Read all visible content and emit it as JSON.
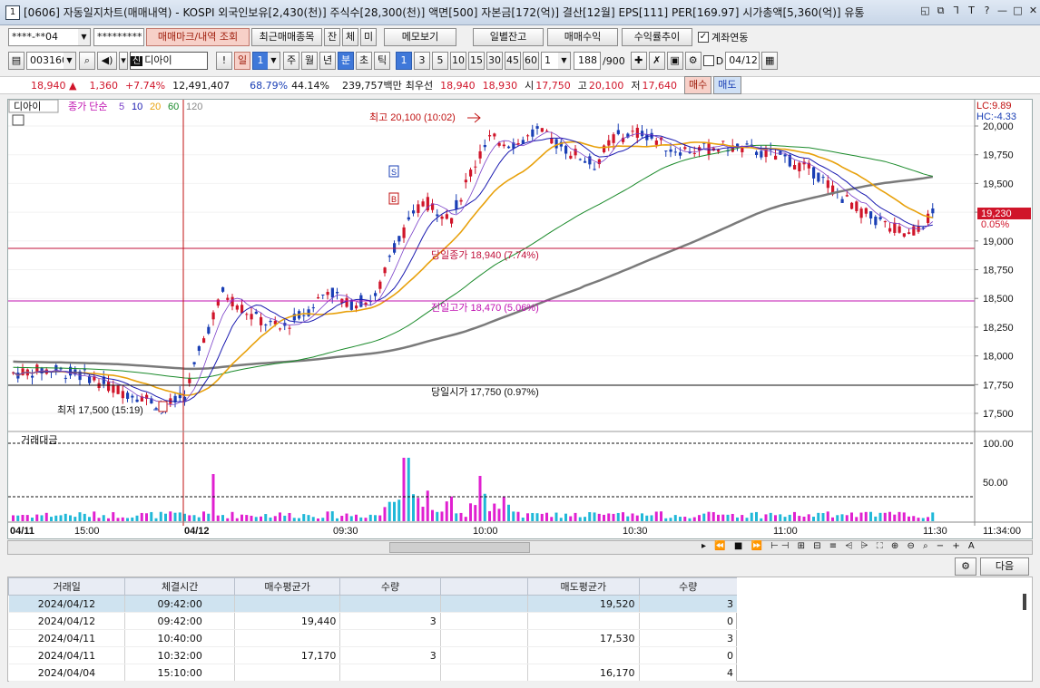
{
  "window": {
    "num": "1",
    "title": "[0606] 자동일지차트(매매내역) - KOSPI 외국인보유[2,430(천)] 주식수[28,300(천)] 액면[500] 자본금[172(억)] 결산[12월] EPS[111] PER[169.97] 시가총액[5,360(억)] 유통"
  },
  "titlebtns": [
    "◱",
    "⧉",
    "ᒣ",
    "T",
    "?",
    "—",
    "□",
    "✕"
  ],
  "toolbar1": {
    "account": "****-**04",
    "password": "*********",
    "btn_markview": "매매마크/내역 조회",
    "btn_recent": "최근매매종목",
    "btn_jan": "잔",
    "btn_che": "체",
    "btn_mi": "미",
    "btn_memo": "메모보기",
    "btn_daily": "일별잔고",
    "btn_profit": "매매수익",
    "btn_yield": "수익률추이",
    "chk_link": "계좌연동"
  },
  "toolbar2": {
    "code": "003160",
    "badge": "신",
    "name": "디아이",
    "excl": "!",
    "il": "일",
    "il_num": "1",
    "periods": [
      "주",
      "월",
      "년"
    ],
    "bun": "분",
    "cho": "초",
    "tik": "틱",
    "mins": [
      "1",
      "3",
      "5",
      "10",
      "15",
      "30",
      "45",
      "60"
    ],
    "min_sel": "1",
    "count": "1",
    "bars": "188",
    "bars_total": "/900",
    "chk_d": "D",
    "date": "04/12"
  },
  "quote": {
    "price": "18,940 ▲",
    "change": "1,360",
    "rate": "+7.74%",
    "volume": "12,491,407",
    "vr1": "68.79%",
    "vr2": "44.14%",
    "amount": "239,757백만",
    "best_label": "최우선",
    "best1": "18,940",
    "best2": "18,930",
    "open_l": "시",
    "open": "17,750",
    "high_l": "고",
    "high": "20,100",
    "low_l": "저",
    "low": "17,640",
    "buy": "매수",
    "sell": "매도"
  },
  "legend": {
    "name": "디아이",
    "label": "종가 단순",
    "ma": [
      "5",
      "10",
      "20",
      "60",
      "120"
    ]
  },
  "annotations": {
    "high": "최고 20,100 (10:02)",
    "low": "최저 17,500 (15:19)",
    "close": "당일종가 18,940 (7.74%)",
    "prevhigh": "전일고가 18,470 (5.06%)",
    "open": "당일시가 17,750 (0.97%)",
    "lc": "LC:9.89",
    "hc": "HC:-4.33",
    "last": "19,230",
    "last_pct": "0.05%",
    "marker_s": "S",
    "marker_b": "B"
  },
  "yticks": [
    "20,000",
    "19,750",
    "19,500",
    "19,250",
    "19,000",
    "18,750",
    "18,500",
    "18,250",
    "18,000",
    "17,750",
    "17,500"
  ],
  "volume": {
    "label": "거래대금",
    "ticks": [
      "100.00",
      "50.00"
    ]
  },
  "xaxis": {
    "ticks": [
      "04/11",
      "15:00",
      "04/12",
      "09:30",
      "10:00",
      "10:30",
      "11:00",
      "11:30"
    ],
    "clock": "11:34:00"
  },
  "colors": {
    "up": "#d0152a",
    "down": "#1a3fb5",
    "ma5": "#7a3fc8",
    "ma10": "#1a1ab0",
    "ma20": "#e8a10c",
    "ma60": "#1a8a2a",
    "ma120": "#7a7a7a",
    "vol_up": "#e020d0",
    "vol_dn": "#20b8d8"
  },
  "bottom": {
    "next": "다음",
    "headers": [
      "거래일",
      "체결시간",
      "매수평균가",
      "수량",
      "",
      "매도평균가",
      "수량"
    ],
    "rows": [
      [
        "2024/04/12",
        "09:42:00",
        "",
        "",
        "",
        "19,520",
        "3"
      ],
      [
        "2024/04/12",
        "09:42:00",
        "19,440",
        "3",
        "",
        "",
        "0"
      ],
      [
        "2024/04/11",
        "10:40:00",
        "",
        "",
        "",
        "17,530",
        "3"
      ],
      [
        "2024/04/11",
        "10:32:00",
        "17,170",
        "3",
        "",
        "",
        "0"
      ],
      [
        "2024/04/04",
        "15:10:00",
        "",
        "",
        "",
        "16,170",
        "4"
      ]
    ]
  },
  "chart_data": {
    "type": "candlestick",
    "ylim": [
      17350,
      20150
    ],
    "price_path": [
      [
        0,
        17850
      ],
      [
        8,
        17880
      ],
      [
        16,
        17820
      ],
      [
        22,
        17700
      ],
      [
        27,
        17650
      ],
      [
        32,
        17560
      ],
      [
        36,
        17650
      ],
      [
        40,
        18150
      ],
      [
        44,
        18550
      ],
      [
        50,
        18350
      ],
      [
        56,
        18230
      ],
      [
        62,
        18400
      ],
      [
        66,
        18580
      ],
      [
        70,
        18450
      ],
      [
        76,
        18500
      ],
      [
        80,
        18950
      ],
      [
        86,
        19350
      ],
      [
        92,
        19200
      ],
      [
        96,
        19600
      ],
      [
        100,
        19880
      ],
      [
        106,
        19850
      ],
      [
        110,
        19950
      ],
      [
        116,
        19800
      ],
      [
        122,
        19660
      ],
      [
        126,
        19900
      ],
      [
        132,
        19950
      ],
      [
        138,
        19800
      ],
      [
        144,
        19790
      ],
      [
        150,
        19820
      ],
      [
        156,
        19780
      ],
      [
        162,
        19720
      ],
      [
        168,
        19600
      ],
      [
        174,
        19380
      ],
      [
        180,
        19200
      ],
      [
        188,
        19050
      ],
      [
        193,
        19230
      ]
    ],
    "open": 17750,
    "close": 18940,
    "prev_high": 18470,
    "high": 20100,
    "low": 17500
  }
}
